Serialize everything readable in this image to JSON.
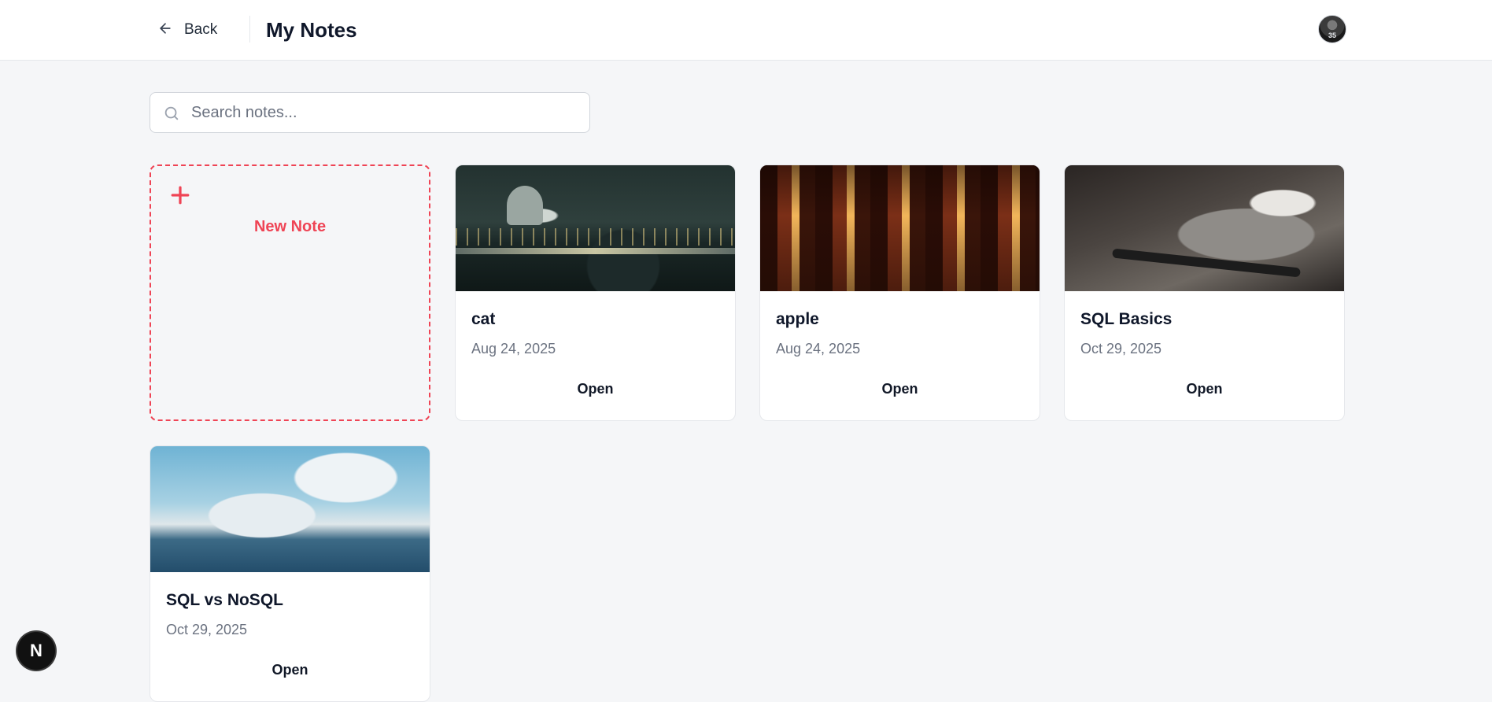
{
  "header": {
    "back_label": "Back",
    "title": "My Notes",
    "avatar_text": "35"
  },
  "search": {
    "placeholder": "Search notes...",
    "value": ""
  },
  "new_note": {
    "label": "New Note"
  },
  "notes": [
    {
      "title": "cat",
      "date": "Aug 24, 2025",
      "action": "Open"
    },
    {
      "title": "apple",
      "date": "Aug 24, 2025",
      "action": "Open"
    },
    {
      "title": "SQL Basics",
      "date": "Oct 29, 2025",
      "action": "Open"
    },
    {
      "title": "SQL vs NoSQL",
      "date": "Oct 29, 2025",
      "action": "Open"
    }
  ],
  "dev_badge": {
    "label": "N"
  },
  "colors": {
    "accent": "#ef4455",
    "background": "#f5f6f8",
    "card": "#ffffff"
  }
}
